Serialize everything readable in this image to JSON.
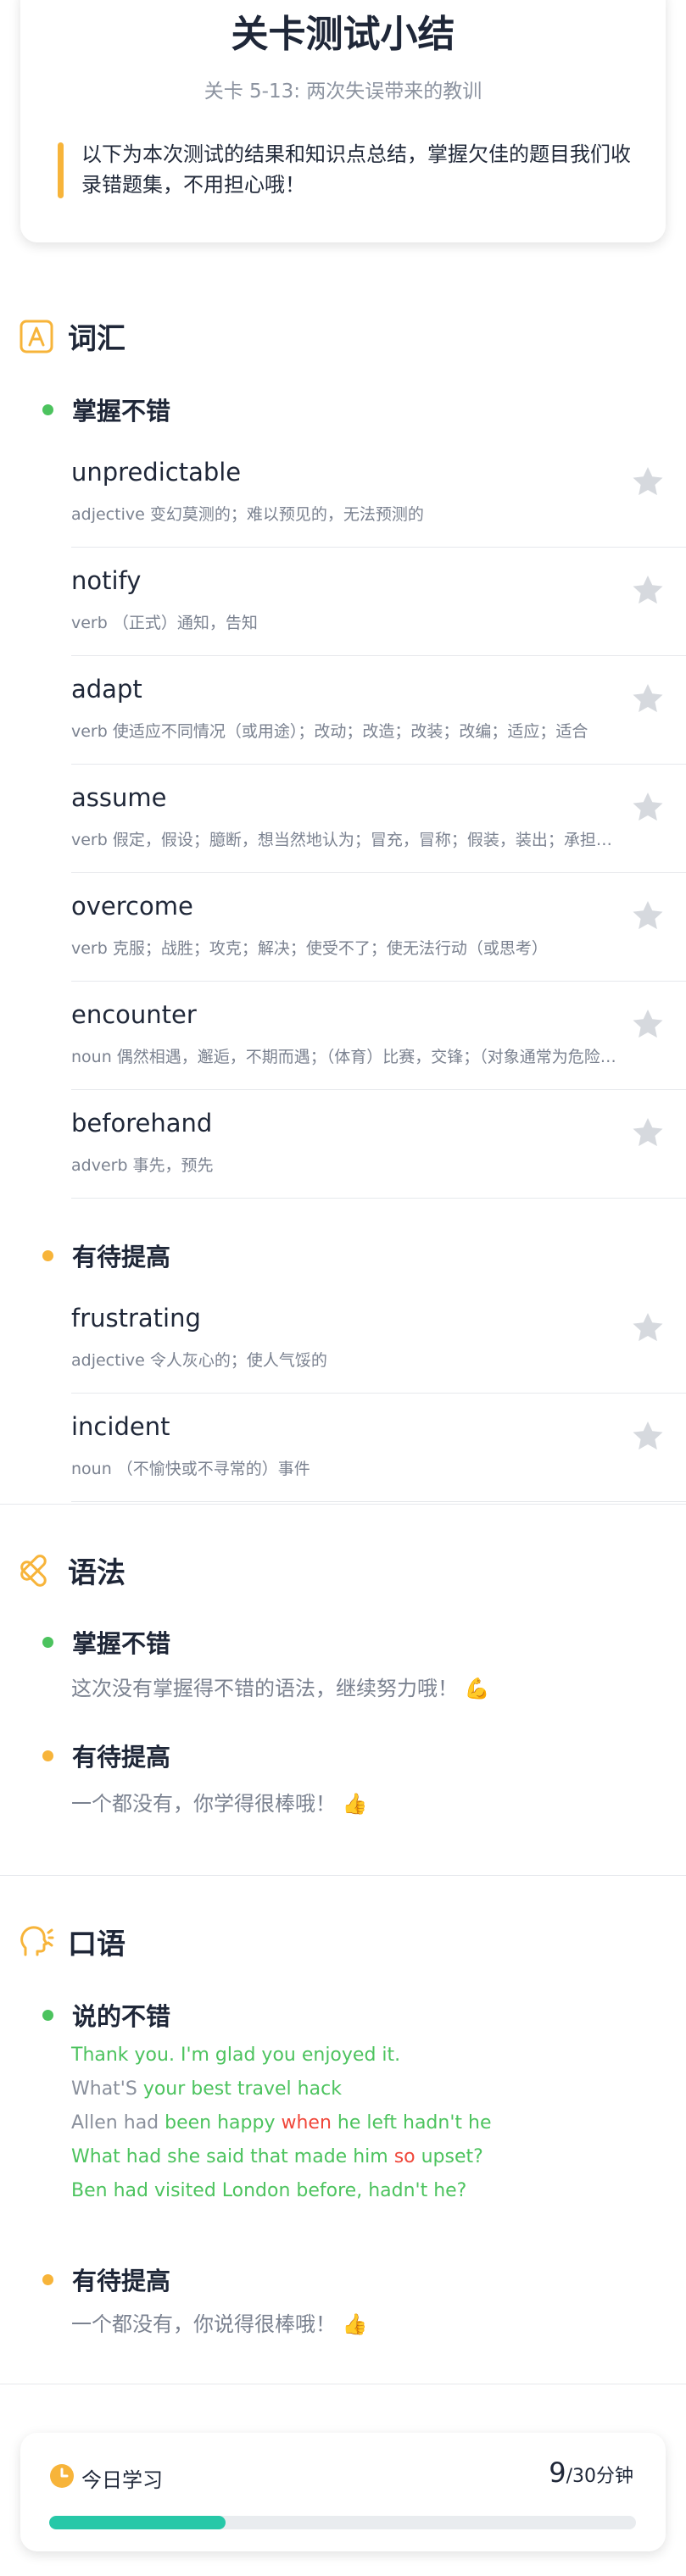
{
  "summary": {
    "title": "关卡测试小结",
    "subtitle": "关卡 5-13: 两次失误带来的教训",
    "note": "以下为本次测试的结果和知识点总结，掌握欠佳的题目我们收录错题集，不用担心哦！"
  },
  "vocabulary": {
    "title": "词汇",
    "icon": "vocabulary-a-icon",
    "mastered_label": "掌握不错",
    "improve_label": "有待提高",
    "mastered": [
      {
        "word": "unpredictable",
        "def": "adjective 变幻莫测的；难以预见的，无法预测的"
      },
      {
        "word": "notify",
        "def": "verb （正式）通知，告知"
      },
      {
        "word": "adapt",
        "def": "verb 使适应不同情况（或用途）；改动；改造；改装；改编；适应；适合"
      },
      {
        "word": "assume",
        "def": "verb 假定，假设；臆断，想当然地认为；冒充，冒称；假装，装出；承担，担任"
      },
      {
        "word": "overcome",
        "def": "verb 克服；战胜；攻克；解决；使受不了；使无法行动（或思考）"
      },
      {
        "word": "encounter",
        "def": "noun 偶然相遇，邂逅，不期而遇；（体育）比赛，交锋；（对象通常为危险或困难）遭遇"
      },
      {
        "word": "beforehand",
        "def": "adverb 事先，预先"
      }
    ],
    "improve": [
      {
        "word": "frustrating",
        "def": "adjective 令人灰心的；使人气馁的"
      },
      {
        "word": "incident",
        "def": "noun （不愉快或不寻常的）事件"
      }
    ]
  },
  "grammar": {
    "title": "语法",
    "icon": "grammar-knot-icon",
    "mastered_label": "掌握不错",
    "mastered_text": "这次没有掌握得不错的语法，继续努力哦！",
    "improve_label": "有待提高",
    "improve_text": "一个都没有，你学得很棒哦！"
  },
  "speaking": {
    "title": "口语",
    "icon": "speaking-head-icon",
    "good_label": "说的不错",
    "sentences": [
      [
        {
          "t": "Thank you. I'm glad you enjoyed it.",
          "c": "g"
        }
      ],
      [
        {
          "t": "What'S ",
          "c": ""
        },
        {
          "t": "your best travel hack",
          "c": "g"
        }
      ],
      [
        {
          "t": "Allen had ",
          "c": ""
        },
        {
          "t": "been happy ",
          "c": "g"
        },
        {
          "t": "when",
          "c": "r"
        },
        {
          "t": " he left hadn't he",
          "c": "g"
        }
      ],
      [
        {
          "t": "What had she said that made him ",
          "c": "g"
        },
        {
          "t": "so",
          "c": "r"
        },
        {
          "t": " upset?",
          "c": "g"
        }
      ],
      [
        {
          "t": "Ben had visited London before, hadn't he?",
          "c": "g"
        }
      ]
    ],
    "improve_label": "有待提高",
    "improve_text": "一个都没有，你说得很棒哦！"
  },
  "today": {
    "label": "今日学习",
    "current": "9",
    "total_suffix": "/30分钟",
    "progress_fraction": 0.3
  },
  "colors": {
    "green": "#4cc35e",
    "orange": "#f7b43a",
    "red": "#f0473a",
    "progress": "#27c8a8"
  }
}
